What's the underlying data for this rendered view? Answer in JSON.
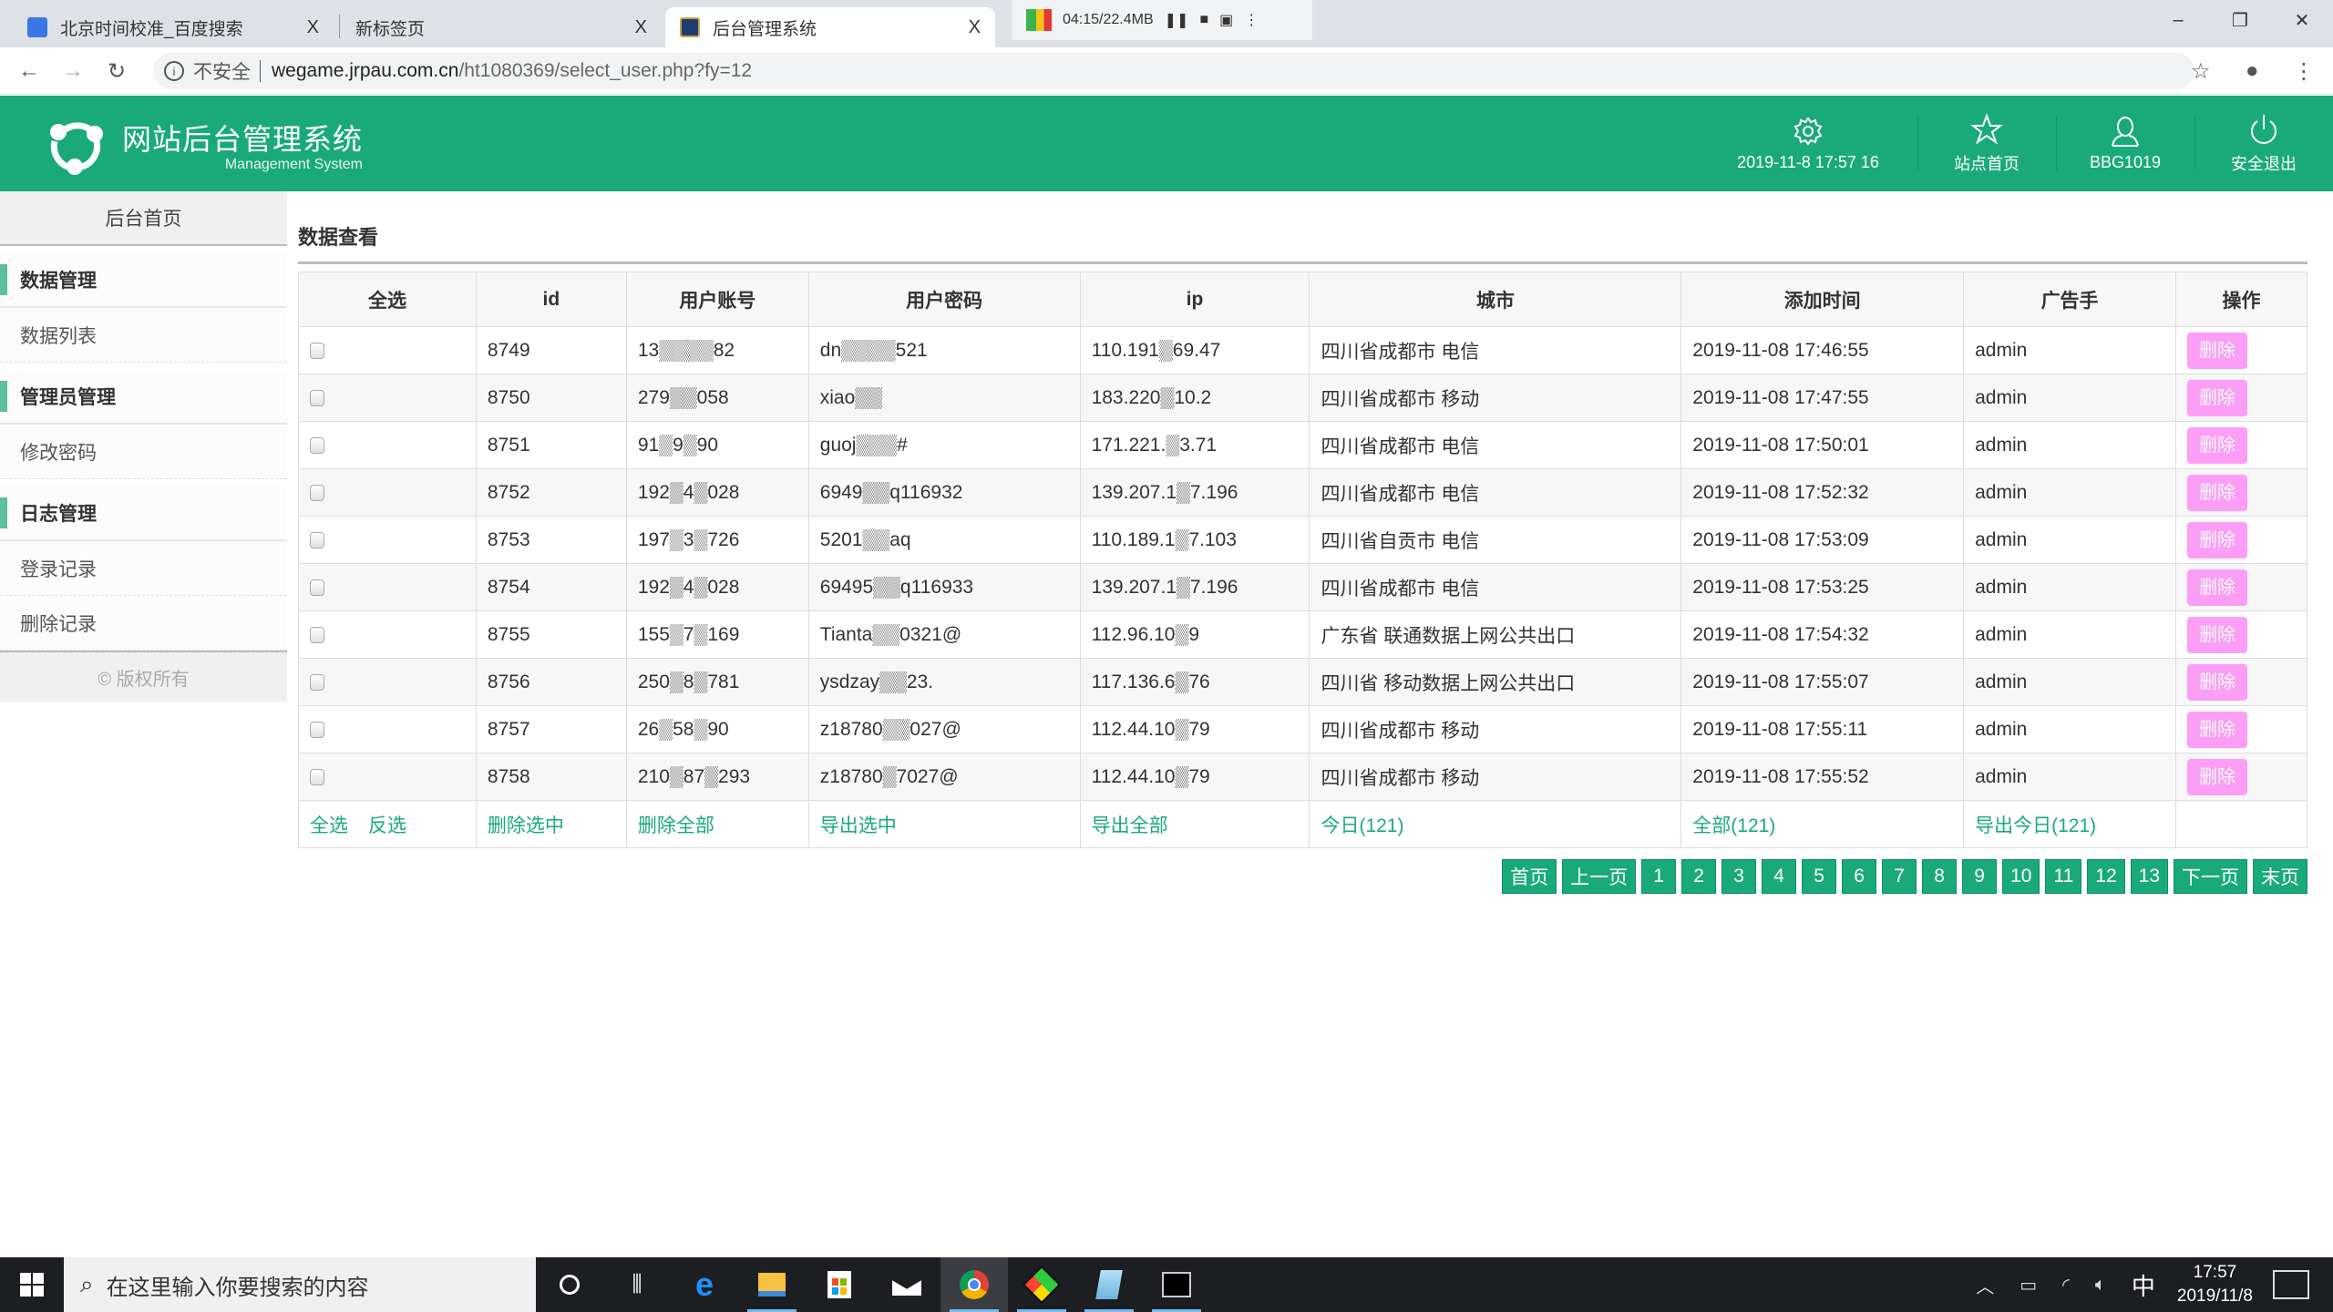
{
  "browser": {
    "tabs": [
      {
        "title": "北京时间校准_百度搜索",
        "icon": "baidu-paw-icon",
        "close": "X"
      },
      {
        "title": "新标签页",
        "icon": "",
        "close": "X"
      },
      {
        "title": "后台管理系统",
        "icon": "league-logo-icon",
        "close": "X",
        "active": true
      }
    ],
    "recorder": {
      "status": "04:15/22.4MB"
    },
    "window_controls": {
      "minimize": "–",
      "restore": "❐",
      "close": "✕"
    },
    "address": {
      "security_label": "不安全",
      "host": "wegame.jrpau.com.cn",
      "path": "/ht1080369/select_user.php?fy=12"
    }
  },
  "header": {
    "logo_title": "网站后台管理系统",
    "logo_subtitle": "Management System",
    "nav": [
      {
        "label": "2019-11-8 17:57 16",
        "icon": "gear-icon"
      },
      {
        "label": "站点首页",
        "icon": "star-icon"
      },
      {
        "label": "BBG1019",
        "icon": "user-icon"
      },
      {
        "label": "安全退出",
        "icon": "power-icon"
      }
    ],
    "colors": {
      "brand": "#1aaa7a",
      "delete": "#fc9ef6"
    }
  },
  "sidebar": {
    "home": "后台首页",
    "groups": [
      {
        "title": "数据管理",
        "items": [
          "数据列表"
        ]
      },
      {
        "title": "管理员管理",
        "items": [
          "修改密码"
        ]
      },
      {
        "title": "日志管理",
        "items": [
          "登录记录",
          "删除记录"
        ]
      }
    ],
    "copyright": "© 版权所有"
  },
  "main": {
    "title": "数据查看",
    "table": {
      "headers": [
        "全选",
        "id",
        "用户账号",
        "用户密码",
        "ip",
        "城市",
        "添加时间",
        "广告手",
        "操作"
      ],
      "delete_label": "删除",
      "rows": [
        {
          "id": "8749",
          "account": "13▒▒▒▒82",
          "password": "dn▒▒▒▒521",
          "ip": "110.191▒69.47",
          "city": "四川省成都市 电信",
          "time": "2019-11-08 17:46:55",
          "ad": "admin"
        },
        {
          "id": "8750",
          "account": "279▒▒058",
          "password": "xiao▒▒",
          "ip": "183.220▒10.2",
          "city": "四川省成都市 移动",
          "time": "2019-11-08 17:47:55",
          "ad": "admin"
        },
        {
          "id": "8751",
          "account": "91▒9▒90",
          "password": "guoj▒▒▒#",
          "ip": "171.221.▒3.71",
          "city": "四川省成都市 电信",
          "time": "2019-11-08 17:50:01",
          "ad": "admin"
        },
        {
          "id": "8752",
          "account": "192▒4▒028",
          "password": "6949▒▒q116932",
          "ip": "139.207.1▒7.196",
          "city": "四川省成都市 电信",
          "time": "2019-11-08 17:52:32",
          "ad": "admin"
        },
        {
          "id": "8753",
          "account": "197▒3▒726",
          "password": "5201▒▒aq",
          "ip": "110.189.1▒7.103",
          "city": "四川省自贡市 电信",
          "time": "2019-11-08 17:53:09",
          "ad": "admin"
        },
        {
          "id": "8754",
          "account": "192▒4▒028",
          "password": "69495▒▒q116933",
          "ip": "139.207.1▒7.196",
          "city": "四川省成都市 电信",
          "time": "2019-11-08 17:53:25",
          "ad": "admin"
        },
        {
          "id": "8755",
          "account": "155▒7▒169",
          "password": "Tianta▒▒0321@",
          "ip": "112.96.10▒9",
          "city": "广东省 联通数据上网公共出口",
          "time": "2019-11-08 17:54:32",
          "ad": "admin"
        },
        {
          "id": "8756",
          "account": "250▒8▒781",
          "password": "ysdzay▒▒23.",
          "ip": "117.136.6▒76",
          "city": "四川省 移动数据上网公共出口",
          "time": "2019-11-08 17:55:07",
          "ad": "admin"
        },
        {
          "id": "8757",
          "account": "26▒58▒90",
          "password": "z18780▒▒027@",
          "ip": "112.44.10▒79",
          "city": "四川省成都市 移动",
          "time": "2019-11-08 17:55:11",
          "ad": "admin"
        },
        {
          "id": "8758",
          "account": "210▒87▒293",
          "password": "z18780▒7027@",
          "ip": "112.44.10▒79",
          "city": "四川省成都市 移动",
          "time": "2019-11-08 17:55:52",
          "ad": "admin"
        }
      ],
      "footer": {
        "select_all": "全选",
        "invert": "反选",
        "delete_selected": "删除选中",
        "delete_all": "删除全部",
        "export_selected": "导出选中",
        "export_all": "导出全部",
        "today": "今日(121)",
        "all": "全部(121)",
        "export_today": "导出今日(121)"
      }
    },
    "pager": [
      "首页",
      "上一页",
      "1",
      "2",
      "3",
      "4",
      "5",
      "6",
      "7",
      "8",
      "9",
      "10",
      "11",
      "12",
      "13",
      "下一页",
      "末页"
    ]
  },
  "taskbar": {
    "search_placeholder": "在这里输入你要搜索的内容",
    "apps": [
      "cortana-icon",
      "task-view-icon",
      "edge-icon",
      "file-explorer-icon",
      "store-icon",
      "mail-icon",
      "chrome-icon",
      "app-icon",
      "notepad-icon",
      "terminal-icon"
    ],
    "ime": "中",
    "time": "17:57",
    "date": "2019/11/8"
  }
}
